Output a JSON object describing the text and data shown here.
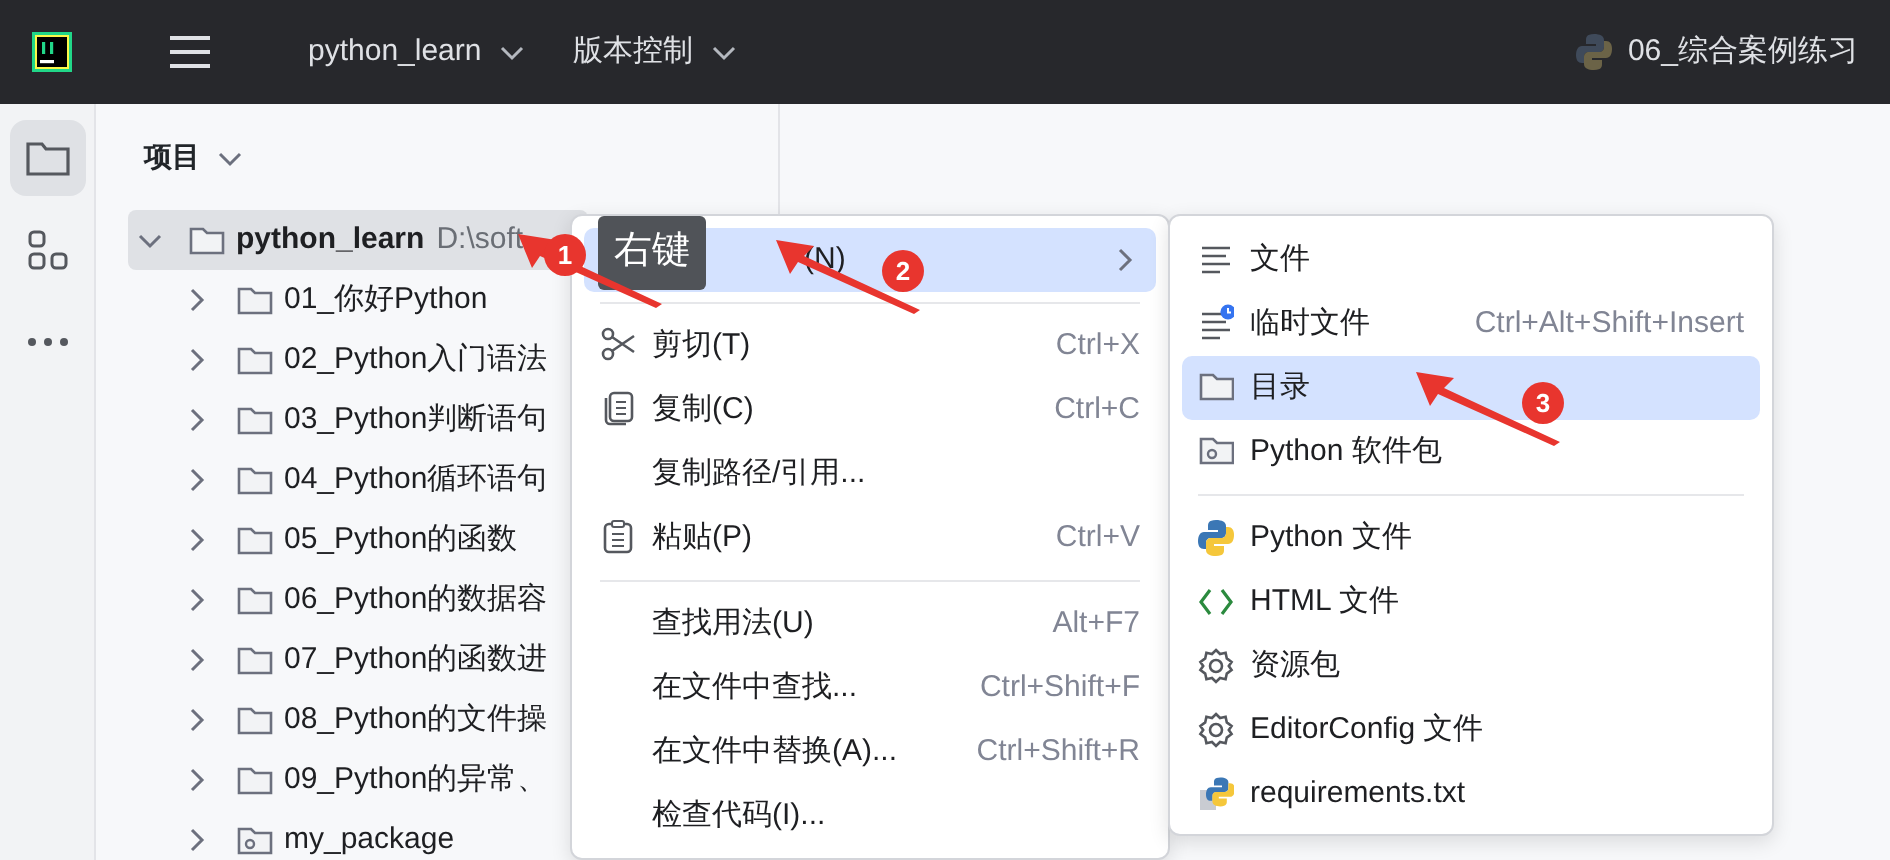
{
  "top_bar": {
    "project": "python_learn",
    "vcs": "版本控制",
    "run_config": "06_综合案例练习"
  },
  "tool_strip": [
    {
      "kind": "folder",
      "selected": true
    },
    {
      "kind": "structure",
      "selected": false
    },
    {
      "kind": "more",
      "selected": false
    }
  ],
  "project_panel": {
    "title": "项目",
    "tree": [
      {
        "kind": "folder",
        "label": "python_learn",
        "path": "D:\\soft",
        "expanded": true,
        "selected": true,
        "children": [
          {
            "kind": "folder",
            "label": "01_你好Python",
            "expanded": false,
            "selected": false
          },
          {
            "kind": "folder",
            "label": "02_Python入门语法",
            "expanded": false,
            "selected": false
          },
          {
            "kind": "folder",
            "label": "03_Python判断语句",
            "expanded": false,
            "selected": false
          },
          {
            "kind": "folder",
            "label": "04_Python循环语句",
            "expanded": false,
            "selected": false
          },
          {
            "kind": "folder",
            "label": "05_Python的函数",
            "expanded": false,
            "selected": false
          },
          {
            "kind": "folder",
            "label": "06_Python的数据容",
            "expanded": false,
            "selected": false
          },
          {
            "kind": "folder",
            "label": "07_Python的函数进",
            "expanded": false,
            "selected": false
          },
          {
            "kind": "folder",
            "label": "08_Python的文件操",
            "expanded": false,
            "selected": false
          },
          {
            "kind": "folder",
            "label": "09_Python的异常、",
            "expanded": false,
            "selected": false
          },
          {
            "kind": "package",
            "label": "my_package",
            "expanded": false,
            "selected": false
          }
        ]
      }
    ]
  },
  "context_menu": {
    "items": [
      {
        "kind": "plain",
        "label": "(N)",
        "selected": true,
        "submenu": true
      },
      {
        "kind": "separator"
      },
      {
        "kind": "cut",
        "label": "剪切(T)",
        "shortcut": "Ctrl+X",
        "selected": false,
        "submenu": false
      },
      {
        "kind": "copy",
        "label": "复制(C)",
        "shortcut": "Ctrl+C",
        "selected": false,
        "submenu": false
      },
      {
        "kind": "plain",
        "label": "复制路径/引用...",
        "selected": false,
        "submenu": false
      },
      {
        "kind": "paste",
        "label": "粘贴(P)",
        "shortcut": "Ctrl+V",
        "selected": false,
        "submenu": false
      },
      {
        "kind": "separator"
      },
      {
        "kind": "plain",
        "label": "查找用法(U)",
        "shortcut": "Alt+F7",
        "selected": false,
        "submenu": false
      },
      {
        "kind": "plain",
        "label": "在文件中查找...",
        "shortcut": "Ctrl+Shift+F",
        "selected": false,
        "submenu": false
      },
      {
        "kind": "plain",
        "label": "在文件中替换(A)...",
        "shortcut": "Ctrl+Shift+R",
        "selected": false,
        "submenu": false
      },
      {
        "kind": "plain",
        "label": "检查代码(I)...",
        "selected": false,
        "submenu": false
      }
    ]
  },
  "submenu": {
    "items": [
      {
        "kind": "file",
        "label": "文件",
        "selected": false
      },
      {
        "kind": "scratch",
        "label": "临时文件",
        "shortcut": "Ctrl+Alt+Shift+Insert",
        "selected": false
      },
      {
        "kind": "folder",
        "label": "目录",
        "selected": true
      },
      {
        "kind": "package",
        "label": "Python 软件包",
        "selected": false
      },
      {
        "kind": "separator"
      },
      {
        "kind": "python",
        "label": "Python 文件",
        "selected": false
      },
      {
        "kind": "html",
        "label": "HTML 文件",
        "selected": false
      },
      {
        "kind": "gear",
        "label": "资源包",
        "selected": false
      },
      {
        "kind": "gear",
        "label": "EditorConfig 文件",
        "selected": false
      },
      {
        "kind": "requirements",
        "label": "requirements.txt",
        "selected": false
      }
    ]
  },
  "tooltip": "右键",
  "annotations": [
    {
      "number": "1"
    },
    {
      "number": "2"
    },
    {
      "number": "3"
    }
  ]
}
